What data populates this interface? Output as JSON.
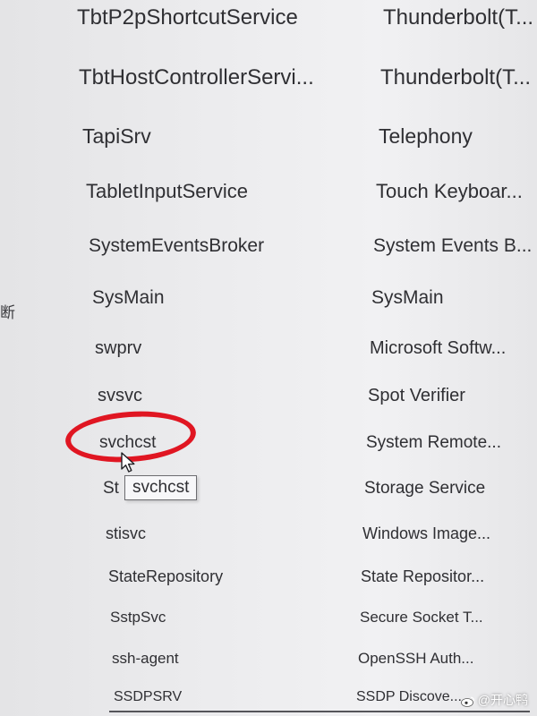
{
  "side_label": "断",
  "services": [
    {
      "name": "TbtP2pShortcutService",
      "display_name": "Thunderbolt(T..."
    },
    {
      "name": "TbtHostControllerServi...",
      "display_name": "Thunderbolt(T..."
    },
    {
      "name": "TapiSrv",
      "display_name": "Telephony"
    },
    {
      "name": "TabletInputService",
      "display_name": "Touch Keyboar..."
    },
    {
      "name": "SystemEventsBroker",
      "display_name": "System Events B..."
    },
    {
      "name": "SysMain",
      "display_name": "SysMain"
    },
    {
      "name": "swprv",
      "display_name": "Microsoft Softw..."
    },
    {
      "name": "svsvc",
      "display_name": "Spot Verifier"
    },
    {
      "name": "svchcst",
      "display_name": "System Remote..."
    },
    {
      "name": "St",
      "display_name": "Storage Service"
    },
    {
      "name": "stisvc",
      "display_name": "Windows Image..."
    },
    {
      "name": "StateRepository",
      "display_name": "State Repositor..."
    },
    {
      "name": "SstpSvc",
      "display_name": "Secure Socket T..."
    },
    {
      "name": "ssh-agent",
      "display_name": "OpenSSH Auth..."
    },
    {
      "name": "SSDPSRV",
      "display_name": "SSDP Discove..."
    }
  ],
  "tooltip": {
    "text": "svchcst"
  },
  "watermark": {
    "text": "@开心鸭"
  },
  "colors": {
    "highlight": "#e01622",
    "text": "#2f2f33"
  }
}
